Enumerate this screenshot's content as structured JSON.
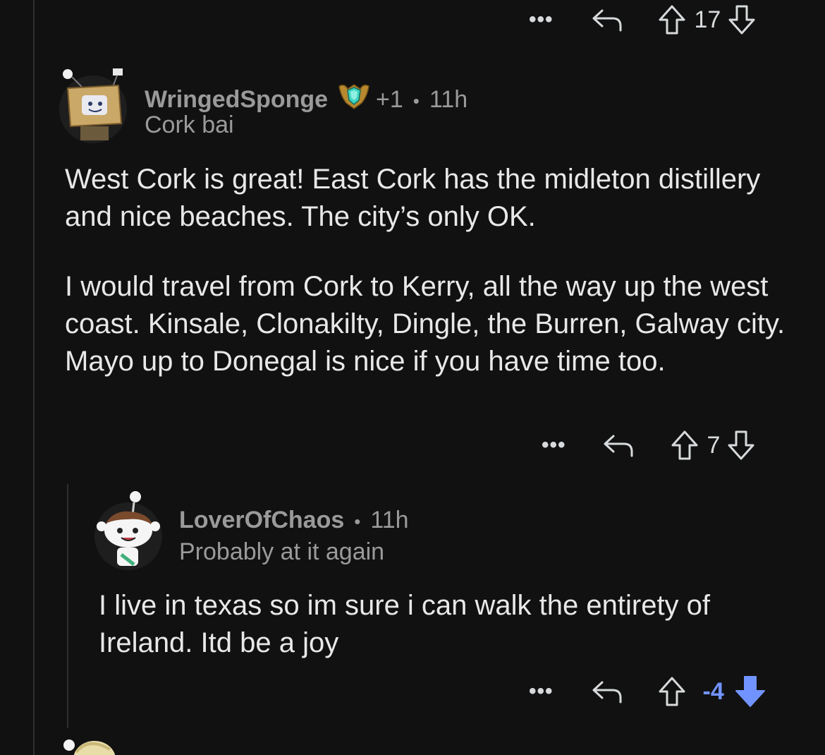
{
  "top_actions": {
    "more": "•••",
    "score": "17"
  },
  "comment1": {
    "username": "WringedSponge",
    "karma": "+1",
    "separator": "•",
    "time": "11h",
    "flair": "Cork bai",
    "body": [
      "West Cork is great! East Cork has the midleton distillery and nice beaches. The city’s only OK.",
      "I would travel from Cork to Kerry, all the way up the west coast. Kinsale, Clonakilty, Dingle, the Burren, Galway city. Mayo up to Donegal is nice if you have time too."
    ],
    "actions": {
      "more": "•••",
      "score": "7"
    }
  },
  "comment2": {
    "username": "LoverOfChaos",
    "separator": "•",
    "time": "11h",
    "flair": "Probably at it again",
    "body": "I live in texas so im sure i can walk the entirety of Ireland. Itd be a joy",
    "actions": {
      "more": "•••",
      "score": "-4"
    }
  },
  "colors": {
    "background": "#111111",
    "text": "#d7dadc",
    "muted": "#9a9a9a",
    "downvote_active": "#7193ff"
  }
}
